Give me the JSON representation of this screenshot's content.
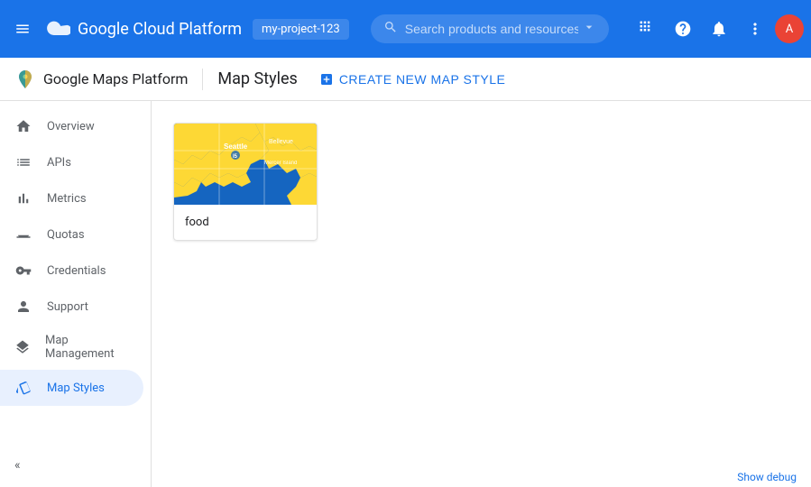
{
  "topBar": {
    "menuIcon": "☰",
    "appName": "Google Cloud Platform",
    "accountLabel": "my-project-123",
    "searchPlaceholder": "Search products and resources",
    "icons": {
      "apps": "⊞",
      "help": "?",
      "bell": "🔔",
      "more": "⋮"
    },
    "avatarInitial": "A"
  },
  "secondaryNav": {
    "brandName": "Google Maps Platform",
    "pageTitle": "Map Styles",
    "createBtn": {
      "label": "CREATE NEW MAP STYLE",
      "icon": "+"
    }
  },
  "sidebar": {
    "items": [
      {
        "id": "overview",
        "label": "Overview",
        "icon": "home"
      },
      {
        "id": "apis",
        "label": "APIs",
        "icon": "list"
      },
      {
        "id": "metrics",
        "label": "Metrics",
        "icon": "bar_chart"
      },
      {
        "id": "quotas",
        "label": "Quotas",
        "icon": "monitor"
      },
      {
        "id": "credentials",
        "label": "Credentials",
        "icon": "key"
      },
      {
        "id": "support",
        "label": "Support",
        "icon": "person"
      },
      {
        "id": "map-management",
        "label": "Map Management",
        "icon": "layers"
      },
      {
        "id": "map-styles",
        "label": "Map Styles",
        "icon": "style",
        "active": true
      }
    ],
    "collapseIcon": "«"
  },
  "content": {
    "mapStyles": [
      {
        "name": "food",
        "thumbnail": "seattle-food-map"
      }
    ]
  },
  "bottomBar": {
    "label": "Show debug"
  }
}
